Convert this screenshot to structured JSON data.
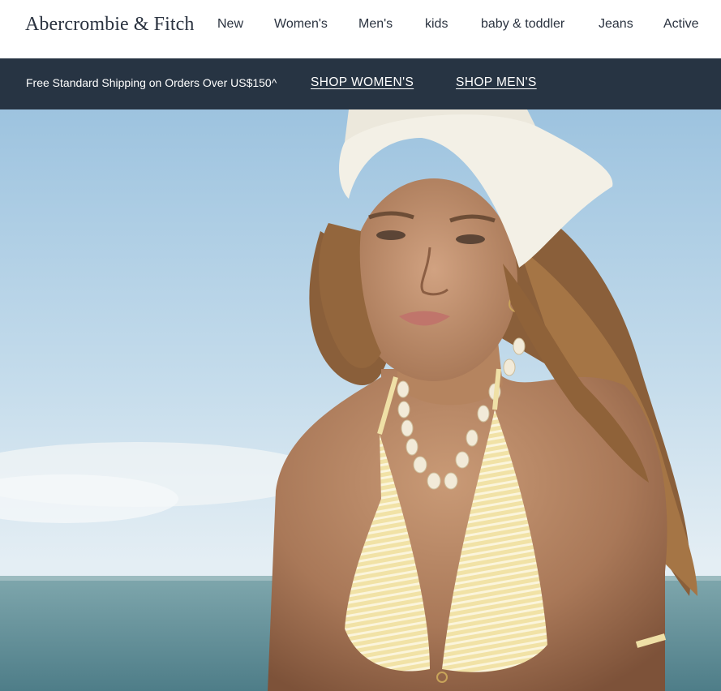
{
  "header": {
    "logo": "Abercrombie & Fitch",
    "nav": [
      "New",
      "Women's",
      "Men's",
      "kids",
      "baby & toddler",
      "Jeans",
      "Active"
    ]
  },
  "promo": {
    "shipping_text": "Free Standard Shipping on Orders Over US$150^",
    "shop_womens": "SHOP WOMEN'S",
    "shop_mens": "SHOP MEN'S"
  },
  "colors": {
    "promo_background": "#273443",
    "text_dark": "#2b3340"
  }
}
